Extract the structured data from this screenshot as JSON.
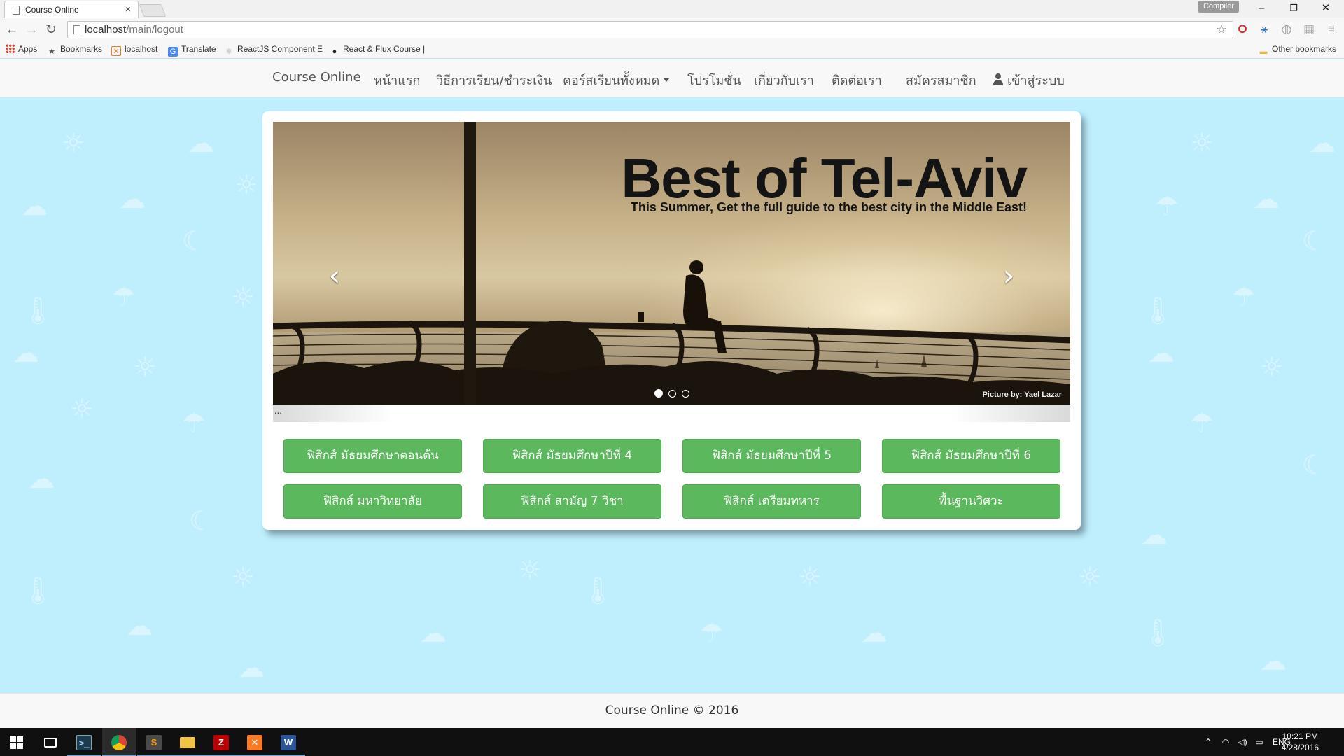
{
  "browser": {
    "tab_title": "Course Online",
    "tab_close": "×",
    "profile_badge": "Compiler",
    "window_controls": {
      "minimize": "–",
      "restore": "❐",
      "close": "✕"
    },
    "nav": {
      "back": "←",
      "forward": "→",
      "reload": "↻"
    },
    "url_host": "localhost",
    "url_path": "/main/logout",
    "bookmarks": [
      {
        "label": "Apps",
        "icon": "apps-grid-icon"
      },
      {
        "label": "Bookmarks",
        "icon": "star-icon"
      },
      {
        "label": "localhost",
        "icon": "xampp-icon"
      },
      {
        "label": "Translate",
        "icon": "translate-icon"
      },
      {
        "label": "ReactJS Component E",
        "icon": "react-icon"
      },
      {
        "label": "React & Flux Course |",
        "icon": "github-icon"
      }
    ],
    "other_bookmarks": "Other bookmarks"
  },
  "navbar": {
    "brand": "Course Online",
    "items": [
      {
        "label": "หน้าแรก"
      },
      {
        "label": "วิธีการเรียน/ชำระเงิน"
      },
      {
        "label": "คอร์สเรียนทั้งหมด",
        "dropdown": true
      },
      {
        "label": "โปรโมชั่น"
      },
      {
        "label": "เกี่ยวกับเรา"
      },
      {
        "label": "ติดต่อเรา"
      }
    ],
    "register": "สมัครสมาชิก",
    "login": "เข้าสู่ระบบ"
  },
  "carousel": {
    "title": "Best of Tel-Aviv",
    "subtitle": "This Summer, Get the full guide to the best city in the Middle East!",
    "credit": "Picture by: Yael Lazar",
    "prev": "‹",
    "next": "›",
    "slide_count": 3,
    "active_slide": 1,
    "caption": "..."
  },
  "courses": [
    "ฟิสิกส์ มัธยมศึกษาตอนต้น",
    "ฟิสิกส์ มัธยมศึกษาปีที่ 4",
    "ฟิสิกส์ มัธยมศึกษาปีที่ 5",
    "ฟิสิกส์ มัธยมศึกษาปีที่ 6",
    "ฟิสิกส์ มหาวิทยาลัย",
    "ฟิสิกส์ สามัญ 7 วิชา",
    "ฟิสิกส์ เตรียมทหาร",
    "พื้นฐานวิศวะ"
  ],
  "footer": {
    "text": "Course Online © 2016"
  },
  "taskbar": {
    "language": "ENG",
    "time": "10:21 PM",
    "date": "4/28/2016",
    "apps": [
      "start",
      "task-view",
      "terminal",
      "chrome",
      "sublime",
      "file-explorer",
      "filezilla",
      "xampp",
      "word"
    ]
  },
  "colors": {
    "page_background": "#bfeefc",
    "button_green": "#5cb85c",
    "navbar": "#f8f8f8",
    "taskbar": "#101010"
  }
}
